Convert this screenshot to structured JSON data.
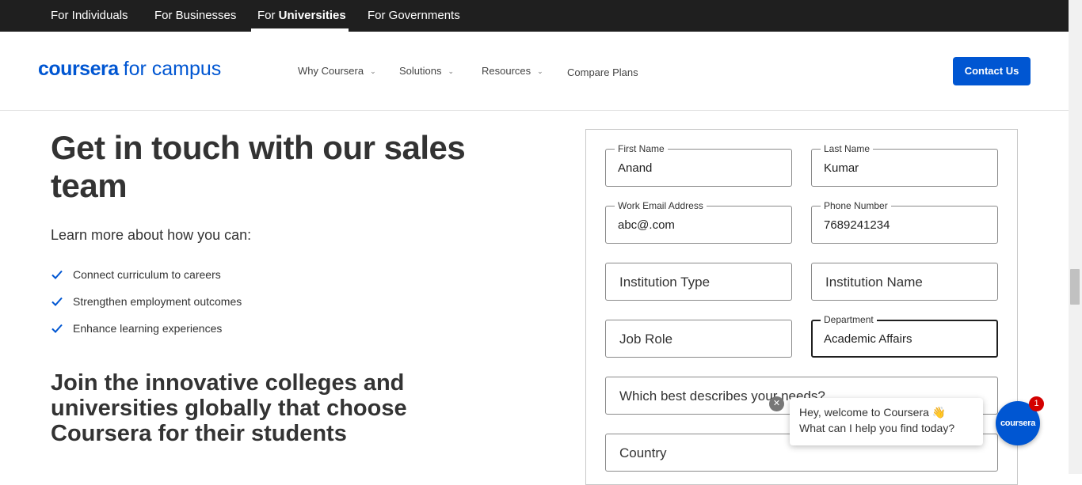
{
  "topbar": {
    "tabs": [
      {
        "label": "For Individuals"
      },
      {
        "label": "For Businesses"
      },
      {
        "label_prefix": "For ",
        "label_bold": "Universities"
      },
      {
        "label": "For Governments"
      }
    ]
  },
  "header": {
    "logo_brand": "coursera",
    "logo_suffix": "for campus",
    "nav": [
      {
        "label": "Why Coursera",
        "has_dropdown": true
      },
      {
        "label": "Solutions",
        "has_dropdown": true
      },
      {
        "label": "Resources",
        "has_dropdown": true
      },
      {
        "label": "Compare Plans",
        "has_dropdown": false
      }
    ],
    "contact_label": "Contact Us"
  },
  "main": {
    "title": "Get in touch with our sales team",
    "lead": "Learn more about how you can:",
    "bullets": [
      "Connect curriculum to careers",
      "Strengthen employment outcomes",
      "Enhance learning experiences"
    ],
    "subtitle": "Join the innovative colleges and universities globally that choose Coursera for their students"
  },
  "form": {
    "first_name": {
      "label": "First Name",
      "value": "Anand"
    },
    "last_name": {
      "label": "Last Name",
      "value": "Kumar"
    },
    "email": {
      "label": "Work Email Address",
      "value": "abc@.com"
    },
    "phone": {
      "label": "Phone Number",
      "value": "7689241234"
    },
    "institution_type": {
      "placeholder": "Institution Type"
    },
    "institution_name": {
      "placeholder": "Institution Name"
    },
    "job_role": {
      "placeholder": "Job Role"
    },
    "department": {
      "label": "Department",
      "value": "Academic Affairs"
    },
    "needs": {
      "placeholder": "Which best describes your needs?"
    },
    "country": {
      "placeholder": "Country"
    }
  },
  "chat": {
    "line1": "Hey, welcome to Coursera 👋",
    "line2": "What can I help you find today?",
    "close_glyph": "✕",
    "button_label": "coursera",
    "badge_count": "1"
  },
  "colors": {
    "brand_blue": "#0056d2",
    "topbar_bg": "#1f1f1f",
    "badge_red": "#d30000"
  }
}
